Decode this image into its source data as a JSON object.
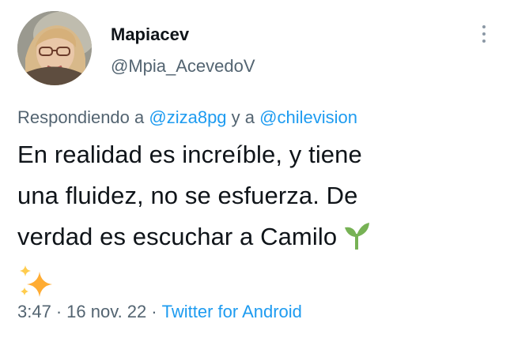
{
  "user": {
    "display_name": "Mapiacev",
    "handle": "@Mpia_AcevedoV"
  },
  "reply": {
    "prefix": "Respondiendo a",
    "mention_1": "@ziza8pg",
    "connector": "y a",
    "mention_2": "@chilevision"
  },
  "tweet": {
    "line_1": "En realidad es increíble, y tiene",
    "line_2": "una fluidez, no se esfuerza. De",
    "line_3": "verdad es escuchar a Camilo",
    "emojis": [
      "seedling-icon",
      "sparkles-icon"
    ]
  },
  "meta": {
    "time": "3:47",
    "date": "16 nov. 22",
    "separator": "·",
    "source": "Twitter for Android"
  },
  "colors": {
    "text": "#0f1419",
    "secondary": "#536471",
    "link": "#1d9bf0"
  }
}
